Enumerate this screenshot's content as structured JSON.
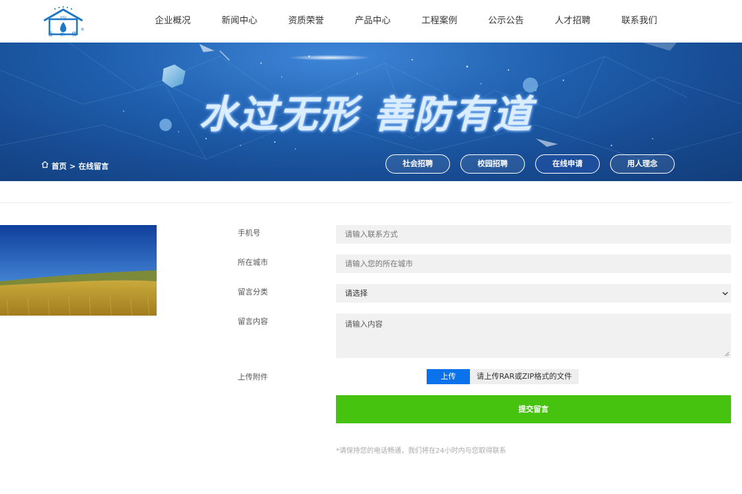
{
  "brand": {
    "logo_abbr": "YSJ",
    "logo_text": "音 水 情",
    "registered_mark": "®"
  },
  "nav": {
    "items": [
      {
        "label": "企业概况"
      },
      {
        "label": "新闻中心"
      },
      {
        "label": "资质荣誉"
      },
      {
        "label": "产品中心"
      },
      {
        "label": "工程案例"
      },
      {
        "label": "公示公告"
      },
      {
        "label": "人才招聘"
      },
      {
        "label": "联系我们"
      }
    ]
  },
  "banner": {
    "slogan": "水过无形  善防有道",
    "breadcrumb": {
      "home": "首页",
      "separator": ">",
      "current": "在线留言"
    },
    "tabs": [
      {
        "label": "社会招聘"
      },
      {
        "label": "校园招聘"
      },
      {
        "label": "在线申请",
        "active": true
      },
      {
        "label": "用人理念"
      }
    ]
  },
  "form": {
    "phone": {
      "label": "手机号",
      "placeholder": "请输入联系方式"
    },
    "city": {
      "label": "所在城市",
      "placeholder": "请输入您的所在城市"
    },
    "category": {
      "label": "留言分类",
      "selected": "请选择"
    },
    "content": {
      "label": "留言内容",
      "placeholder": "请输入内容"
    },
    "attachment": {
      "label": "上传附件",
      "button": "上传",
      "hint": "请上传RAR或ZIP格式的文件"
    },
    "submit": "提交留言",
    "note": "*请保持您的电话畅通，我们将在24小时内与您取得联系"
  },
  "colors": {
    "primary_blue": "#0a73eb",
    "submit_green": "#45c30f",
    "banner_blue": "#1f5fae"
  }
}
